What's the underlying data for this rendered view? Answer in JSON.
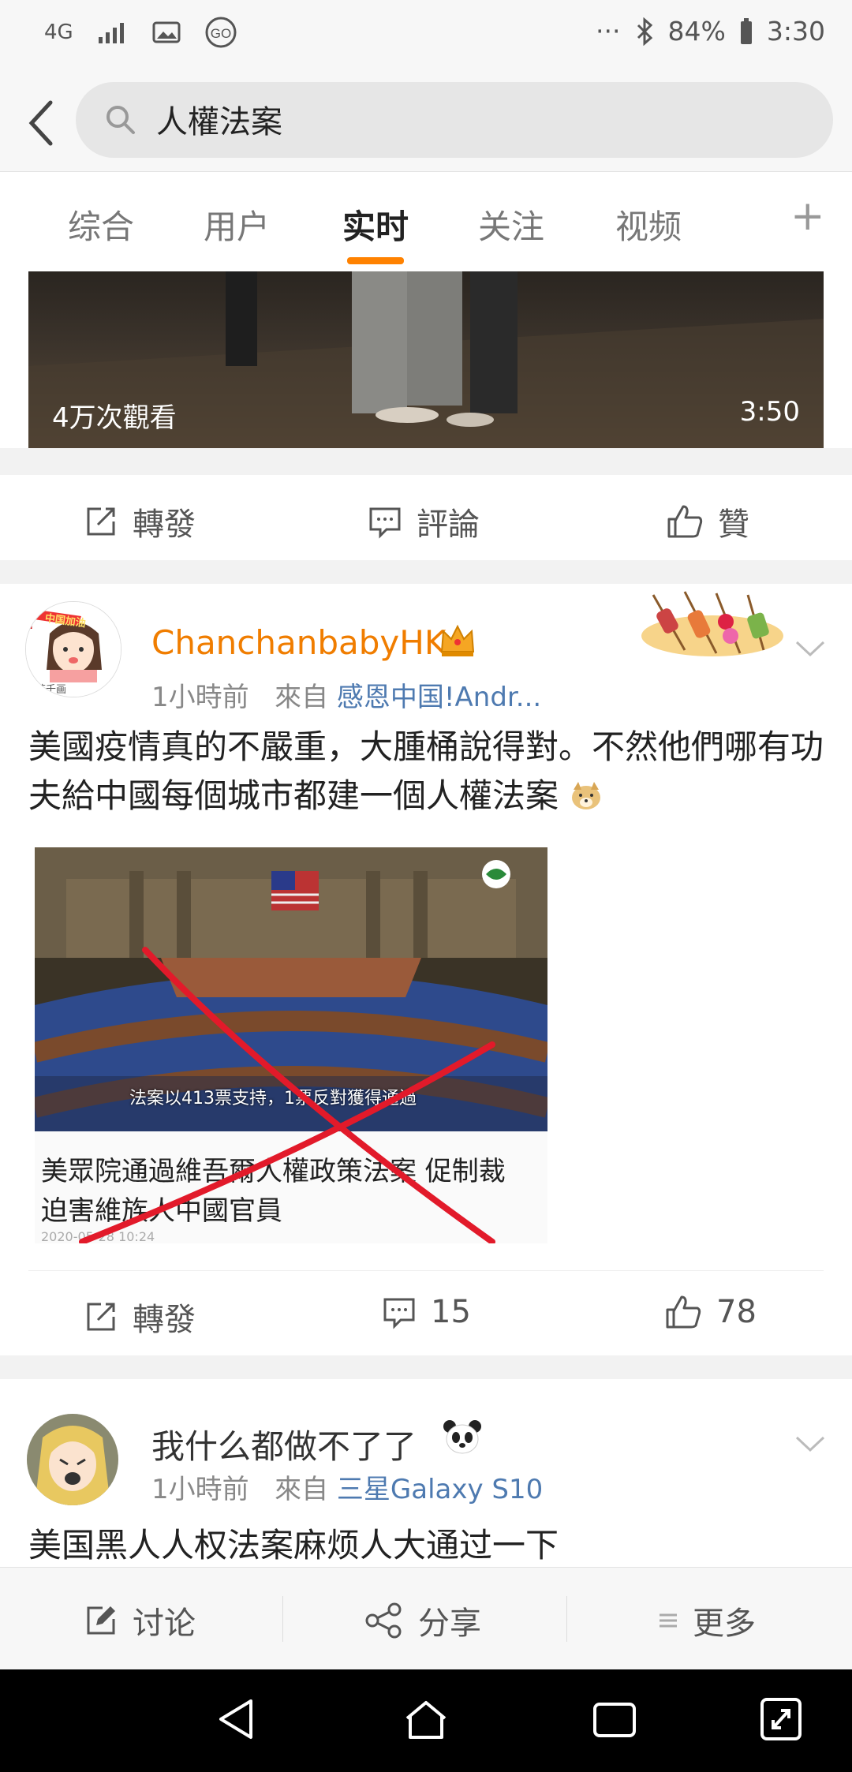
{
  "status_bar": {
    "network": "4G",
    "dots": "···",
    "battery": "84%",
    "time": "3:30"
  },
  "search": {
    "query": "人權法案"
  },
  "tabs": [
    {
      "label": "综合",
      "active": false
    },
    {
      "label": "用户",
      "active": false
    },
    {
      "label": "实时",
      "active": true
    },
    {
      "label": "关注",
      "active": false
    },
    {
      "label": "视频",
      "active": false
    }
  ],
  "tab_plus": "+",
  "video_card": {
    "views": "4万次觀看",
    "duration": "3:50"
  },
  "card1_actions": {
    "repost": "轉發",
    "comment": "評論",
    "like": "贊"
  },
  "post1": {
    "username": "ChanchanbabyHK",
    "time": "1小時前",
    "from_label": "來自",
    "source": "感恩中国!Andr...",
    "text": "美國疫情真的不嚴重，大腫桶說得對。不然他們哪有功夫給中國每個城市都建一個人權法案",
    "image_caption": "法案以413票支持，1票反對獲得通過",
    "headline": "美眾院通過維吾爾人權政策法案 促制裁迫害維族人中國官員",
    "date_fragment": "2020-05-28 10:24",
    "avatar_badge": "中国加油",
    "avatar_tag": "芬千画",
    "actions": {
      "repost": "轉發",
      "comments": "15",
      "likes": "78"
    }
  },
  "post2": {
    "username": "我什么都做不了了",
    "time": "1小時前",
    "from_label": "來自",
    "source": "三星Galaxy S10",
    "text": "美国黑人人权法案麻烦人大通过一下"
  },
  "bottom_bar": {
    "discuss": "讨论",
    "share": "分享",
    "more": "更多"
  },
  "colors": {
    "accent": "#ff8200",
    "username": "#f07d00",
    "link": "#4e7ab0"
  }
}
